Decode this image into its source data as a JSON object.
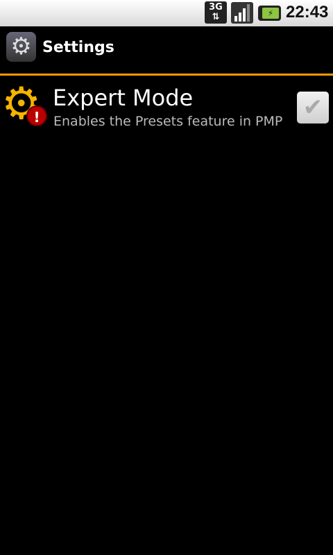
{
  "status_bar": {
    "network": "3G",
    "time": "22:43",
    "icons": [
      "3g-data-icon",
      "signal-icon",
      "battery-charging-icon"
    ]
  },
  "title_bar": {
    "title": "Settings",
    "icon": "settings-gear-icon"
  },
  "accent_color": "#ff9a00",
  "preferences": [
    {
      "title": "Expert Mode",
      "summary": "Enables the Presets feature in PMP",
      "checked": false,
      "icon": "gear-warning-icon"
    }
  ]
}
